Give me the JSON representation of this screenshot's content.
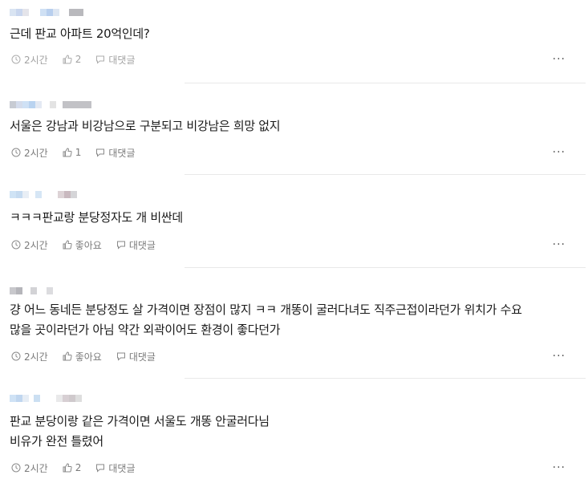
{
  "comments": [
    {
      "text": "근데 판교 아파트 20억인데?",
      "time": "2시간",
      "likes": "2",
      "reply_label": "대댓글",
      "more": "···"
    },
    {
      "text": "서울은 강남과 비강남으로 구분되고 비강남은 희망 없지",
      "time": "2시간",
      "likes": "1",
      "reply_label": "대댓글",
      "more": "···"
    },
    {
      "text": "ㅋㅋㅋ판교랑 분당정자도 개 비싼데",
      "time": "2시간",
      "likes": "좋아요",
      "reply_label": "대댓글",
      "more": "···"
    },
    {
      "text_line1": "걍 어느 동네든 분당정도 살 가격이면 장점이 많지 ㅋㅋ 개똥이 굴러다녀도 직주근접이라던가 위치가 수요",
      "text_line2": "많을 곳이라던가 아님 약간 외곽이어도 환경이 좋다던가",
      "time": "2시간",
      "likes": "좋아요",
      "reply_label": "대댓글",
      "more": "···"
    },
    {
      "text_line1": "판교 분당이랑 같은 가격이면 서울도 개똥 안굴러다님",
      "text_line2": "비유가 완전 틀렸어",
      "time": "2시간",
      "likes": "2",
      "reply_label": "대댓글",
      "more": "···"
    }
  ],
  "colors": {
    "meta_text": "#7a7a7a",
    "separator": "#e9e9e9",
    "text": "#1a1a1a"
  }
}
